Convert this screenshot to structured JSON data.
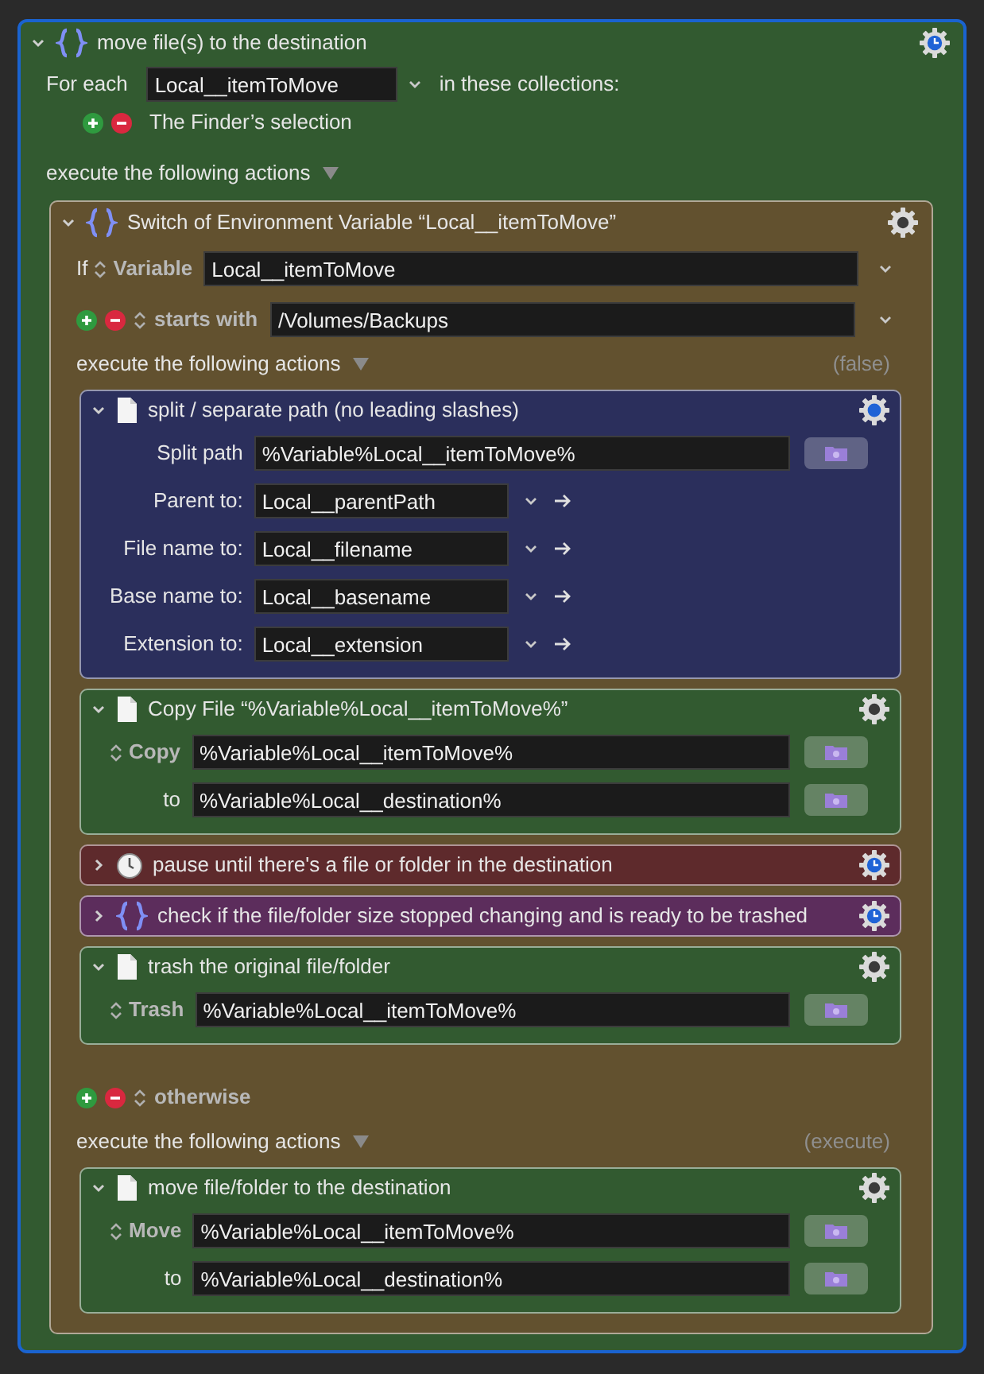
{
  "macro": {
    "title": "move file(s) to the destination",
    "expanded": true,
    "timed": true,
    "for_each": {
      "label": "For each",
      "variable": "Local__itemToMove",
      "suffix": "in these collections:"
    },
    "collections": [
      "The Finder’s selection"
    ],
    "execute_label": "execute the following actions",
    "actions": [
      {
        "kind": "switch",
        "title": "Switch of Environment Variable “Local__itemToMove”",
        "expanded": true,
        "timed": false,
        "if_label": "If",
        "source": "Variable",
        "variable": "Local__itemToMove",
        "cases": [
          {
            "kind": "condition",
            "operator": "starts with",
            "value": "/Volumes/Backups",
            "execute_label": "execute the following actions",
            "status": "(false)",
            "actions": [
              {
                "kind": "file",
                "color": "#2b2f5c",
                "title": "split / separate path (no leading slashes)",
                "expanded": true,
                "timed": false,
                "highlighted": true,
                "fields": [
                  {
                    "kind": "path",
                    "label": "Split path",
                    "stepper": false,
                    "value": "%Variable%Local__itemToMove%"
                  },
                  {
                    "kind": "variable",
                    "label": "Parent to:",
                    "stepper": false,
                    "value": "Local__parentPath"
                  },
                  {
                    "kind": "variable",
                    "label": "File name to:",
                    "stepper": false,
                    "value": "Local__filename"
                  },
                  {
                    "kind": "variable",
                    "label": "Base name to:",
                    "stepper": false,
                    "value": "Local__basename"
                  },
                  {
                    "kind": "variable",
                    "label": "Extension to:",
                    "stepper": false,
                    "value": "Local__extension"
                  }
                ]
              },
              {
                "kind": "file",
                "color": "#325a30",
                "title": "Copy File “%Variable%Local__itemToMove%”",
                "expanded": true,
                "timed": false,
                "highlighted": false,
                "fields": [
                  {
                    "kind": "path",
                    "label": "Copy",
                    "stepper": true,
                    "value": "%Variable%Local__itemToMove%"
                  },
                  {
                    "kind": "path",
                    "label": "to",
                    "stepper": false,
                    "value": "%Variable%Local__destination%"
                  }
                ]
              },
              {
                "kind": "pause",
                "color": "#5e2a2c",
                "title": "pause until there's a file or folder in the destination",
                "expanded": false,
                "timed": true,
                "highlighted": false
              },
              {
                "kind": "group",
                "color": "#5c2d5c",
                "title": "check if the file/folder size stopped changing and is ready to be trashed",
                "expanded": false,
                "timed": true,
                "highlighted": false
              },
              {
                "kind": "file",
                "color": "#325a30",
                "title": "trash the original file/folder",
                "expanded": true,
                "timed": false,
                "highlighted": false,
                "fields": [
                  {
                    "kind": "path",
                    "label": "Trash",
                    "stepper": true,
                    "value": "%Variable%Local__itemToMove%"
                  }
                ]
              }
            ]
          },
          {
            "kind": "otherwise",
            "operator": "otherwise",
            "execute_label": "execute the following actions",
            "status": "(execute)",
            "actions": [
              {
                "kind": "file",
                "color": "#325a30",
                "title": "move file/folder to the destination",
                "expanded": true,
                "timed": false,
                "highlighted": false,
                "fields": [
                  {
                    "kind": "path",
                    "label": "Move",
                    "stepper": true,
                    "value": "%Variable%Local__itemToMove%"
                  },
                  {
                    "kind": "path",
                    "label": "to",
                    "stepper": false,
                    "value": "%Variable%Local__destination%"
                  }
                ]
              }
            ]
          }
        ]
      }
    ]
  }
}
